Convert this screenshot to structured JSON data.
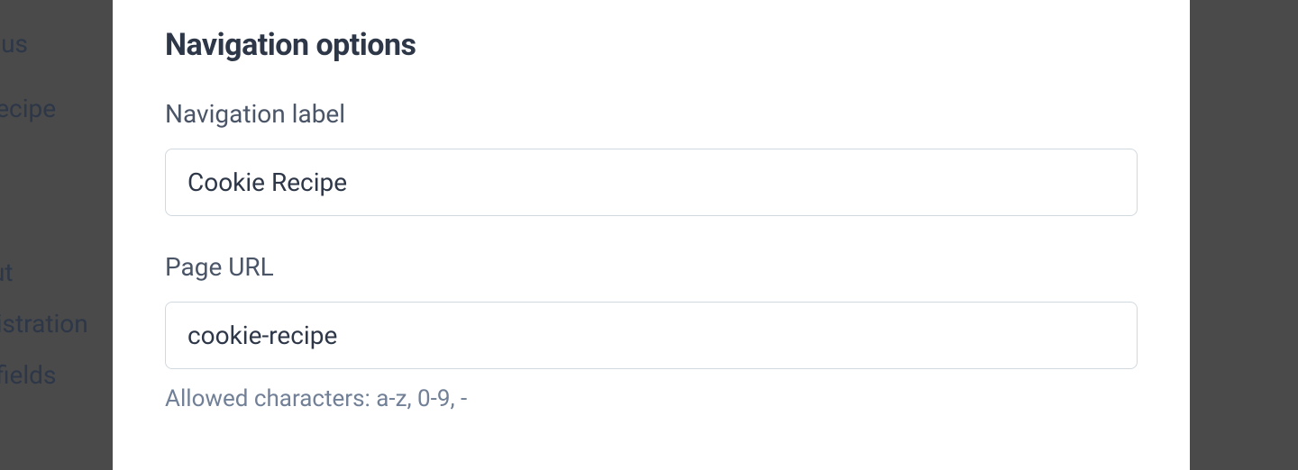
{
  "sidebar": {
    "items": [
      {
        "label": "t us"
      },
      {
        "label": "Cookie Recipe"
      },
      {
        "label": "ut"
      },
      {
        "label": "gistration"
      },
      {
        "label": " fields"
      }
    ]
  },
  "modal": {
    "title": "Navigation options",
    "fields": {
      "navigation_label": {
        "label": "Navigation label",
        "value": "Cookie Recipe"
      },
      "page_url": {
        "label": "Page URL",
        "value": "cookie-recipe",
        "helper": "Allowed characters: a-z, 0-9, -"
      }
    }
  }
}
